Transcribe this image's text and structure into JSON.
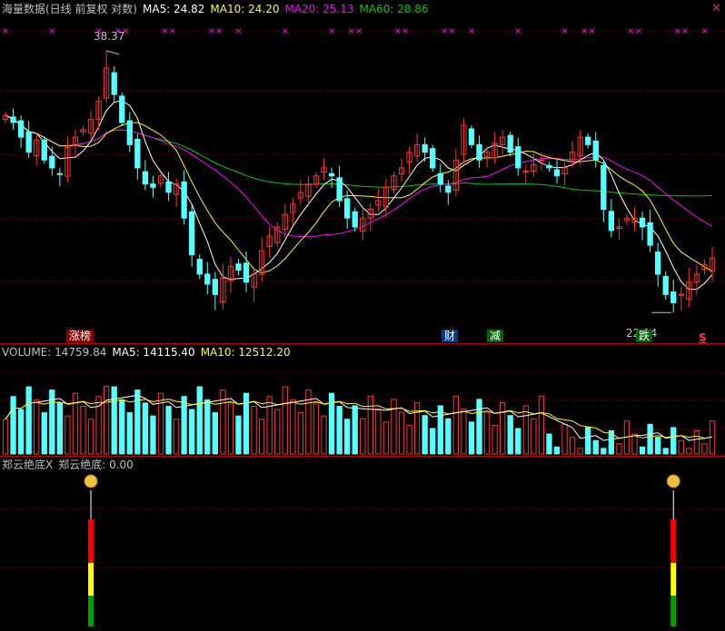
{
  "header": {
    "main": {
      "title": "海量数据(日线 前复权 对数)",
      "ma5_label": "MA5: 24.82",
      "ma10_label": "MA10: 24.20",
      "ma20_label": "MA20: 25.13",
      "ma60_label": "MA60: 28.86"
    },
    "volume": {
      "title": "VOLUME: 14759.84",
      "ma5_label": "MA5: 14115.40",
      "ma10_label": "MA10: 12512.20"
    },
    "indicator": {
      "title": "郑云绝底X",
      "value_label": "郑云绝底: 0.00"
    }
  },
  "annotations": {
    "high_label": "38.37",
    "low_label": "22.14",
    "zhangbang": "涨榜",
    "cai": "财",
    "jian": "减",
    "die": "跌",
    "s_mark": "S"
  },
  "colors": {
    "up": "#ff3232",
    "down": "#54ffff",
    "ma5": "#ffffff",
    "ma10": "#ffff00",
    "ma20": "#ff00ff",
    "ma60": "#00cc00",
    "grid": "#8b0000"
  },
  "chart_data": [
    {
      "type": "candlestick",
      "title": "海量数据(日线 前复权 对数)",
      "ylim": [
        21,
        40
      ],
      "high_marker": 38.37,
      "low_marker": 22.14,
      "series": [
        {
          "name": "MA5",
          "last": 24.82
        },
        {
          "name": "MA10",
          "last": 24.2
        },
        {
          "name": "MA20",
          "last": 25.13
        },
        {
          "name": "MA60",
          "last": 28.86
        }
      ],
      "close": [
        33.5,
        33.0,
        32.0,
        31.0,
        31.8,
        30.5,
        30.0,
        29.6,
        31.3,
        32.0,
        32.5,
        33.2,
        34.5,
        37.0,
        35.0,
        33.0,
        31.5,
        30.0,
        29.0,
        28.8,
        29.5,
        28.5,
        29.0,
        27.0,
        25.0,
        24.0,
        23.5,
        23.0,
        23.8,
        24.4,
        24.2,
        23.6,
        24.0,
        25.2,
        26.0,
        26.5,
        27.2,
        27.8,
        28.5,
        29.0,
        29.5,
        30.0,
        29.5,
        28.0,
        27.0,
        26.5,
        27.0,
        27.5,
        28.0,
        28.8,
        29.5,
        30.0,
        31.0,
        31.5,
        31.0,
        30.0,
        29.0,
        28.5,
        30.5,
        32.8,
        31.5,
        30.5,
        31.0,
        31.6,
        32.0,
        31.0,
        30.0,
        29.8,
        30.2,
        30.5,
        30.0,
        29.5,
        30.0,
        31.0,
        32.0,
        31.5,
        30.5,
        27.5,
        26.3,
        26.5,
        27.0,
        27.0,
        26.5,
        25.5,
        24.0,
        23.0,
        22.6,
        23.0,
        23.6,
        24.0,
        24.5,
        24.82
      ]
    },
    {
      "type": "bar",
      "title": "VOLUME",
      "value": 14759.84,
      "series": [
        {
          "name": "MA5",
          "last": 14115.4
        },
        {
          "name": "MA10",
          "last": 12512.2
        }
      ]
    },
    {
      "type": "bar",
      "title": "郑云绝底X",
      "value": 0.0
    }
  ]
}
